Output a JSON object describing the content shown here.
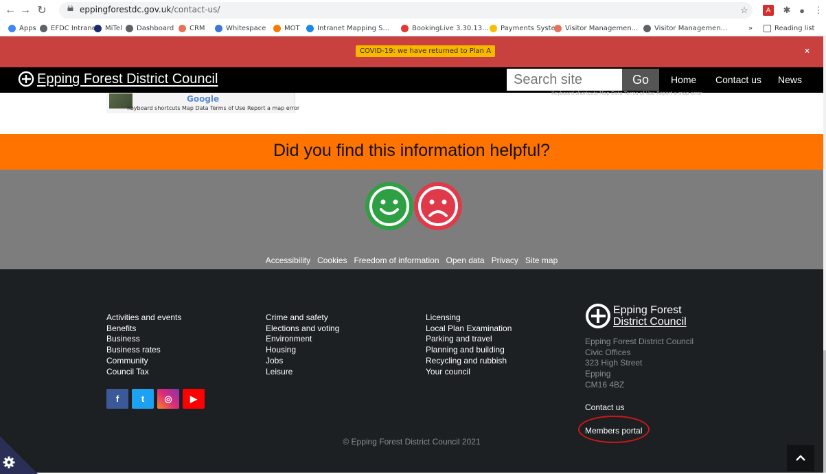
{
  "browser": {
    "url_domain": "eppingforestdc.gov.uk",
    "url_path": "/contact-us/",
    "bookmarks": [
      {
        "label": "Apps",
        "color": "#4285f4"
      },
      {
        "label": "EFDC Intranet",
        "color": "#5f6368"
      },
      {
        "label": "MiTel",
        "color": "#1a2a6c"
      },
      {
        "label": "Dashboard",
        "color": "#5f6368"
      },
      {
        "label": "CRM",
        "color": "#e8735a"
      },
      {
        "label": "Whitespace",
        "color": "#3c78d8"
      },
      {
        "label": "MOT",
        "color": "#f57c00"
      },
      {
        "label": "Intranet Mapping S...",
        "color": "#1e88e5"
      },
      {
        "label": "BookingLive 3.30.13...",
        "color": "#e53935"
      },
      {
        "label": "Payments System",
        "color": "#fbbc04"
      },
      {
        "label": "Visitor Managemen...",
        "color": "#e8735a"
      },
      {
        "label": "Visitor Managemen...",
        "color": "#5f6368"
      }
    ],
    "bookmarks_overflow": "»",
    "reading_list": "Reading list"
  },
  "banner": {
    "covid_text": "COVID-19: we have returned to Plan A",
    "close": "×"
  },
  "header": {
    "site_name": "Epping Forest District Council",
    "search_placeholder": "Search site",
    "search_button": "Go",
    "nav": [
      "Home",
      "Contact us",
      "News"
    ]
  },
  "map": {
    "google": "Google",
    "footer_left": "Keyboard shortcuts   Map Data   Terms of Use   Report a map error",
    "footer_right": "Keyboard shortcuts   Map Data   Terms of Use   Report a map error"
  },
  "feedback": {
    "question": "Did you find this information helpful?",
    "yes_color": "#2ea043",
    "no_color": "#e0394a"
  },
  "footer_links": [
    "Accessibility",
    "Cookies",
    "Freedom of information",
    "Open data",
    "Privacy",
    "Site map"
  ],
  "footer": {
    "col1": [
      "Activities and events",
      "Benefits",
      "Business",
      "Business rates",
      "Community",
      "Council Tax"
    ],
    "col2": [
      "Crime and safety",
      "Elections and voting",
      "Environment",
      "Housing",
      "Jobs",
      "Leisure"
    ],
    "col3": [
      "Licensing",
      "Local Plan Examination",
      "Parking and travel",
      "Planning and building",
      "Recycling and rubbish",
      "Your council"
    ],
    "logo_line1": "Epping Forest",
    "logo_line2": "District Council",
    "address": [
      "Epping Forest District Council",
      "Civic Offices",
      "323 High Street",
      "Epping",
      "CM16 4BZ"
    ],
    "contact_us": "Contact us",
    "members_portal": "Members portal",
    "copyright": "© Epping Forest District Council 2021",
    "social": [
      {
        "name": "facebook",
        "glyph": "f",
        "color": "#3b5998"
      },
      {
        "name": "twitter",
        "glyph": "t",
        "color": "#1da1f2"
      },
      {
        "name": "instagram",
        "glyph": "◎",
        "color": "#c13584"
      },
      {
        "name": "youtube",
        "glyph": "▶",
        "color": "#ff0000"
      }
    ]
  }
}
